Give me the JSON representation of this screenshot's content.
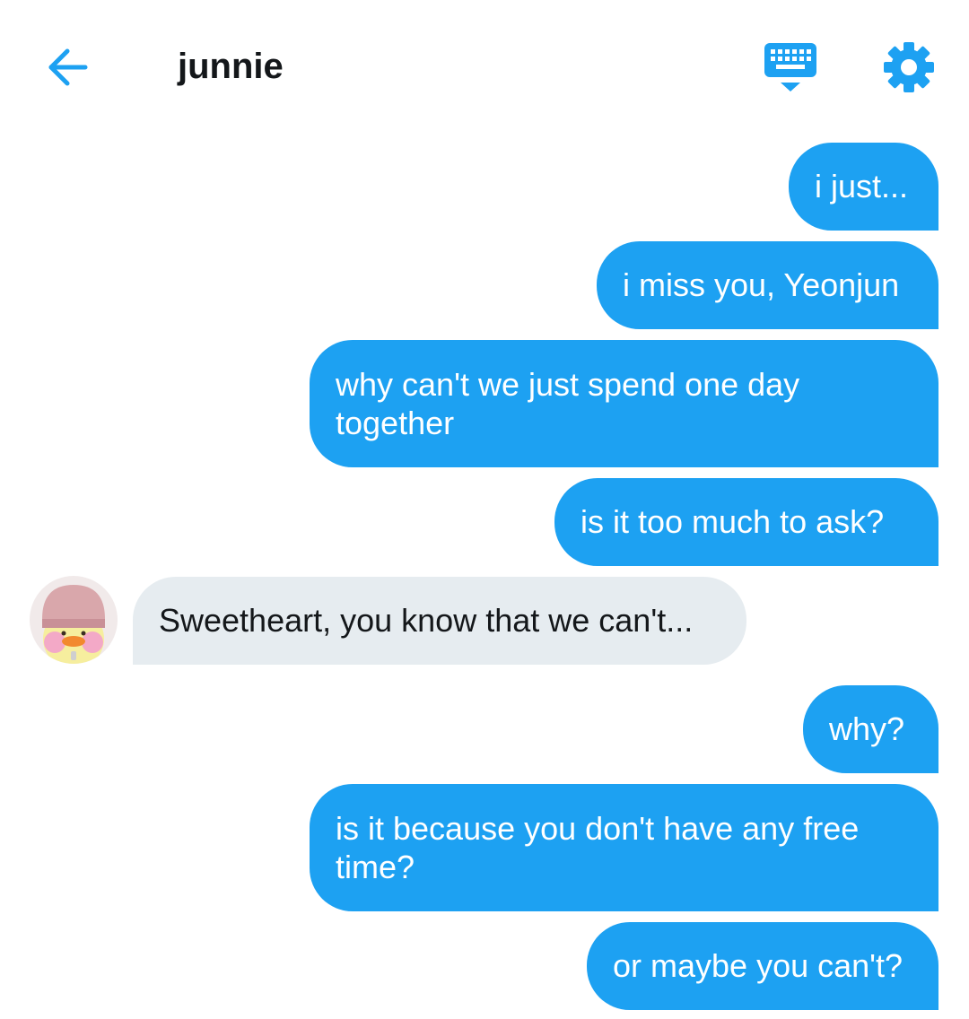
{
  "header": {
    "title": "junnie",
    "back_icon": "arrow-left-icon",
    "keyboard_icon": "keyboard-icon",
    "settings_icon": "gear-icon",
    "accent_color": "#1da1f2"
  },
  "messages": [
    {
      "from": "me",
      "text": "i just..."
    },
    {
      "from": "me",
      "text": "i miss you, Yeonjun"
    },
    {
      "from": "me",
      "line1": "why can't we just spend one day",
      "line2": "together"
    },
    {
      "from": "me",
      "text": "is it too much to ask?"
    },
    {
      "from": "them",
      "text": "Sweetheart, you know that we can't...",
      "avatar": "duck-avatar"
    },
    {
      "from": "me",
      "text": "why?"
    },
    {
      "from": "me",
      "line1": "is it because you don't have any free",
      "line2": "time?"
    },
    {
      "from": "me",
      "text": "or maybe you can't?"
    }
  ],
  "colors": {
    "sent_bubble": "#1da1f2",
    "received_bubble": "#e6ecf0",
    "text_dark": "#14171a"
  }
}
